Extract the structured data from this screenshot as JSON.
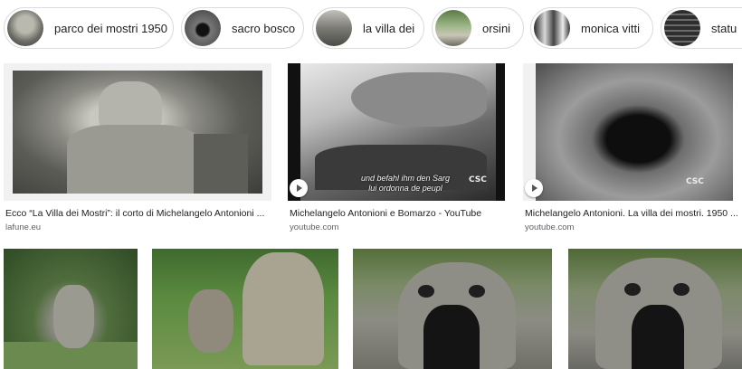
{
  "chips": [
    {
      "label": "parco dei mostri 1950",
      "thumb_icon": "statue-thumbnail"
    },
    {
      "label": "sacro bosco",
      "thumb_icon": "monster-mouth-thumbnail"
    },
    {
      "label": "la villa dei",
      "thumb_icon": "statue-thumbnail"
    },
    {
      "label": "orsini",
      "thumb_icon": "garden-thumbnail"
    },
    {
      "label": "monica vitti",
      "thumb_icon": "people-thumbnail"
    },
    {
      "label": "statu",
      "thumb_icon": "stairs-thumbnail"
    }
  ],
  "results": [
    {
      "caption": "Ecco “La Villa dei Mostri”: il corto di Michelangelo Antonioni ...",
      "source": "lafune.eu",
      "video": false
    },
    {
      "caption": "Michelangelo Antonioni e Bomarzo - YouTube",
      "source": "youtube.com",
      "video": true,
      "subtitle_line1": "und befahl ihm den Sarg",
      "subtitle_line2": "lui ordonna de peupl",
      "watermark": "CSC"
    },
    {
      "caption": "Michelangelo Antonioni. La villa dei mostri. 1950 ...",
      "source": "youtube.com",
      "video": true,
      "watermark": "CSC"
    }
  ],
  "bottom_row_images": [
    {
      "alt": "statue-in-garden-image"
    },
    {
      "alt": "elephant-statue-image"
    },
    {
      "alt": "ogre-mouth-image"
    },
    {
      "alt": "ogre-mouth-image-2"
    }
  ],
  "colors": {
    "chip_border": "#dadce0",
    "text": "#202124",
    "secondary_text": "#5f6368"
  }
}
